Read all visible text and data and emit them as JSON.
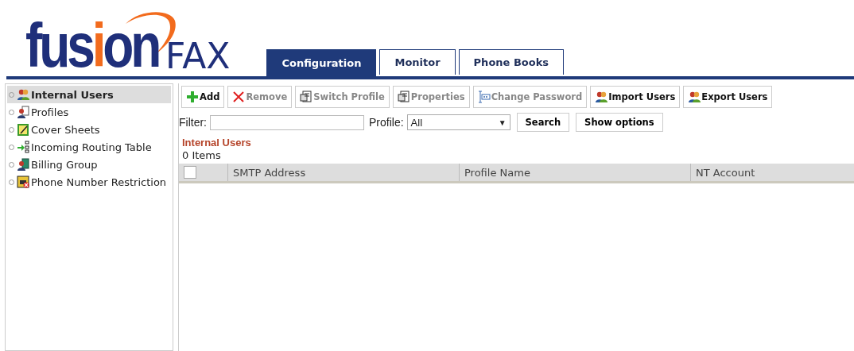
{
  "logo": {
    "parts": [
      {
        "text": "fus",
        "accent": false
      },
      {
        "text": "i",
        "accent": true
      },
      {
        "text": "on",
        "accent": false
      }
    ],
    "product": "FAX"
  },
  "tabs": [
    {
      "label": "Configuration",
      "selected": true
    },
    {
      "label": "Monitor",
      "selected": false
    },
    {
      "label": "Phone Books",
      "selected": false
    }
  ],
  "sidebar": {
    "items": [
      {
        "label": "Internal Users",
        "kind": "users",
        "selected": true
      },
      {
        "label": "Profiles",
        "kind": "profile",
        "selected": false
      },
      {
        "label": "Cover Sheets",
        "kind": "cover",
        "selected": false
      },
      {
        "label": "Incoming Routing Table",
        "kind": "routing",
        "selected": false
      },
      {
        "label": "Billing Group",
        "kind": "billing",
        "selected": false
      },
      {
        "label": "Phone Number Restriction",
        "kind": "restriction",
        "selected": false
      }
    ]
  },
  "toolbar": [
    {
      "label": "Add",
      "kind": "add",
      "disabled": false
    },
    {
      "label": "Remove",
      "kind": "remove",
      "disabled": true
    },
    {
      "label": "Switch Profile",
      "kind": "props",
      "disabled": true
    },
    {
      "label": "Properties",
      "kind": "props",
      "disabled": true
    },
    {
      "label": "Change Password",
      "kind": "password",
      "disabled": true
    },
    {
      "label": "Import Users",
      "kind": "users",
      "disabled": false
    },
    {
      "label": "Export Users",
      "kind": "users",
      "disabled": false
    }
  ],
  "filter": {
    "label": "Filter:",
    "profile_label": "Profile:",
    "profile_value": "All",
    "caret": "▼",
    "search": "Search",
    "show_options": "Show options"
  },
  "list": {
    "title": "Internal Users",
    "count": "0 Items",
    "checked": false,
    "columns": [
      "SMTP Address",
      "Profile Name",
      "NT Account"
    ]
  }
}
